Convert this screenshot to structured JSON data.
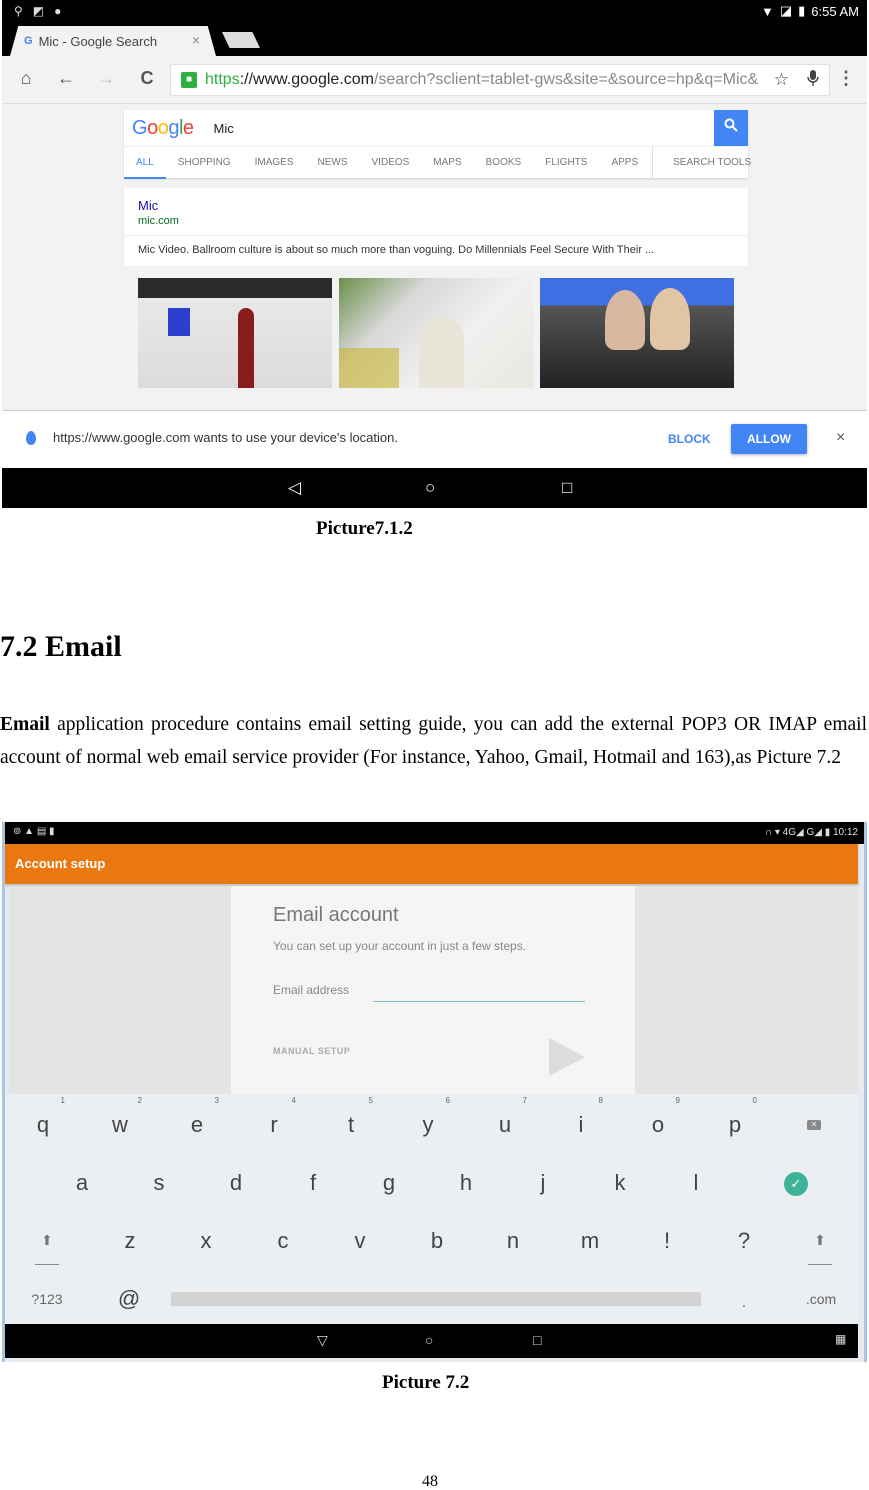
{
  "screenshot1": {
    "status_bar": {
      "left_icons": [
        "usb-icon",
        "no-sim-icon",
        "android-debug-icon"
      ],
      "right_icons": [
        "wifi-icon",
        "no-signal-icon",
        "battery-charging-icon"
      ],
      "time": "6:55 AM"
    },
    "tab": {
      "favicon": "G",
      "title": "Mic - Google Search",
      "close": "×"
    },
    "toolbar": {
      "home": "⌂",
      "back": "←",
      "forward": "→",
      "reload": "C",
      "url_scheme": "https",
      "url_host": "://www.google.com",
      "url_path": "/search?sclient=tablet-gws&site=&source=hp&q=Mic&",
      "star": "☆",
      "mic": "🎤",
      "menu": "⋮"
    },
    "google": {
      "logo_letters": [
        "G",
        "o",
        "o",
        "g",
        "l",
        "e"
      ],
      "query": "Mic",
      "search_icon": "⌕",
      "tabs": [
        "ALL",
        "SHOPPING",
        "IMAGES",
        "NEWS",
        "VIDEOS",
        "MAPS",
        "BOOKS",
        "FLIGHTS",
        "APPS",
        "SEARCH TOOLS"
      ],
      "active_tab": "ALL",
      "result": {
        "title": "Mic",
        "site": "mic.com",
        "snippet": "Mic Video. Ballroom culture is about so much more than voguing. Do Millennials Feel Secure With Their ..."
      },
      "images": [
        "restroom-signs-image",
        "woman-at-table-image",
        "candidates-flag-image"
      ]
    },
    "location_prompt": {
      "text": "https://www.google.com wants to use your device's location.",
      "block": "BLOCK",
      "allow": "ALLOW",
      "close": "×"
    },
    "nav": {
      "back": "◁",
      "home": "○",
      "recents": "□"
    }
  },
  "caption1": "Picture7.1.2",
  "section": {
    "heading": "7.2 Email",
    "para_bold": "Email",
    "para_rest": " application procedure contains email setting guide, you can add the external POP3 OR IMAP email account of normal web email service provider (For instance, Yahoo, Gmail, Hotmail and 163),as Picture 7.2"
  },
  "screenshot2": {
    "status_bar": {
      "left": "⊚ ▲ ▤ ▮",
      "right": "∩ ▾ 4G◢ G◢ ▮ 10:12"
    },
    "action_bar_title": "Account setup",
    "card": {
      "title": "Email account",
      "subtitle": "You can set up your account in just a few steps.",
      "field_label": "Email address",
      "field_value": "",
      "manual_setup": "MANUAL SETUP"
    },
    "keyboard": {
      "row1": [
        "q",
        "w",
        "e",
        "r",
        "t",
        "y",
        "u",
        "i",
        "o",
        "p"
      ],
      "row1_hints": [
        "1",
        "2",
        "3",
        "4",
        "5",
        "6",
        "7",
        "8",
        "9",
        "0"
      ],
      "row2": [
        "a",
        "s",
        "d",
        "f",
        "g",
        "h",
        "j",
        "k",
        "l"
      ],
      "row3": [
        "z",
        "x",
        "c",
        "v",
        "b",
        "n",
        "m",
        "!",
        "?"
      ],
      "shift": "⬆",
      "symbols": "?123",
      "at": "@",
      "period": ".",
      "dotcom": ".com",
      "enter": "✓",
      "backspace": "✕"
    },
    "nav": {
      "back": "▽",
      "home": "○",
      "recents": "□",
      "keyboard": "▦"
    }
  },
  "caption2": "Picture 7.2",
  "page_number": "48"
}
